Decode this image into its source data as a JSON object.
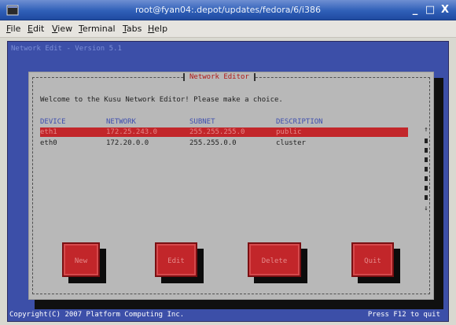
{
  "window": {
    "title": "root@fyan04:.depot/updates/fedora/6/i386",
    "minimize": "_",
    "maximize": "□",
    "close": "X"
  },
  "menu": {
    "items": [
      "File",
      "Edit",
      "View",
      "Terminal",
      "Tabs",
      "Help"
    ]
  },
  "terminal": {
    "top_line": "Network Edit - Version 5.1",
    "status_left": "Copyright(C) 2007 Platform Computing Inc.",
    "status_right": "Press F12 to quit"
  },
  "dialog": {
    "title": "Network Editor",
    "welcome": "Welcome to the Kusu Network Editor! Please make a choice.",
    "columns": [
      "DEVICE",
      "NETWORK",
      "SUBNET",
      "DESCRIPTION"
    ],
    "rows": [
      {
        "device": "eth1",
        "network": "172.25.243.0",
        "subnet": "255.255.255.0",
        "description": "public",
        "selected": true
      },
      {
        "device": "eth0",
        "network": "172.20.0.0",
        "subnet": "255.255.0.0",
        "description": "cluster",
        "selected": false
      }
    ],
    "scroll_up": "↑",
    "scroll_down": "↓",
    "buttons": {
      "new": "New",
      "edit": "Edit",
      "delete": "Delete",
      "quit": "Quit"
    }
  },
  "colors": {
    "terminal_bg": "#3c4fa8",
    "dialog_bg": "#b8b8b8",
    "selection": "#c2262a",
    "header_text": "#3f4fae"
  }
}
